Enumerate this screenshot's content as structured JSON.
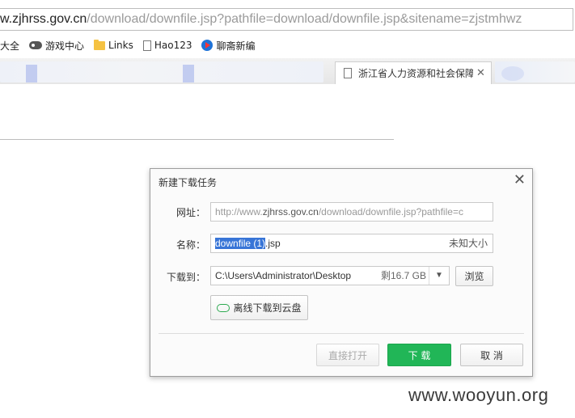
{
  "address_bar": {
    "host": "w.zjhrss.gov.cn",
    "path": "/download/downfile.jsp?pathfile=download/downfile.jsp&sitename=zjstmhwz"
  },
  "bookmarks": [
    {
      "label": "大全",
      "icon": "none"
    },
    {
      "label": "游戏中心",
      "icon": "gamepad-icon"
    },
    {
      "label": "Links",
      "icon": "folder-icon"
    },
    {
      "label": "Hao123",
      "icon": "page-icon"
    },
    {
      "label": "聊斋新编",
      "icon": "news-icon"
    }
  ],
  "tabs": {
    "active_title": "浙江省人力资源和社会保障",
    "close": "✕"
  },
  "dialog": {
    "title": "新建下载任务",
    "close": "✕",
    "url_label": "网址：",
    "url_gray": "http://www.",
    "url_host": "zjhrss.gov.cn",
    "url_rest": "/download/downfile.jsp?pathfile=c",
    "name_label": "名称：",
    "name_selected": "downfile (1)",
    "name_ext": ".jsp",
    "name_size": "未知大小",
    "saveto_label": "下载到：",
    "save_path": "C:\\Users\\Administrator\\Desktop",
    "free_space": "剩16.7 GB",
    "dropdown_arrow": "▼",
    "browse_label": "浏览",
    "cloud_label": "离线下载到云盘",
    "open_label": "直接打开",
    "download_label": "下 载",
    "cancel_label": "取 消"
  },
  "watermark": "www.wooyun.org",
  "colors": {
    "download_button": "#21b657",
    "selection": "#3875d7"
  }
}
